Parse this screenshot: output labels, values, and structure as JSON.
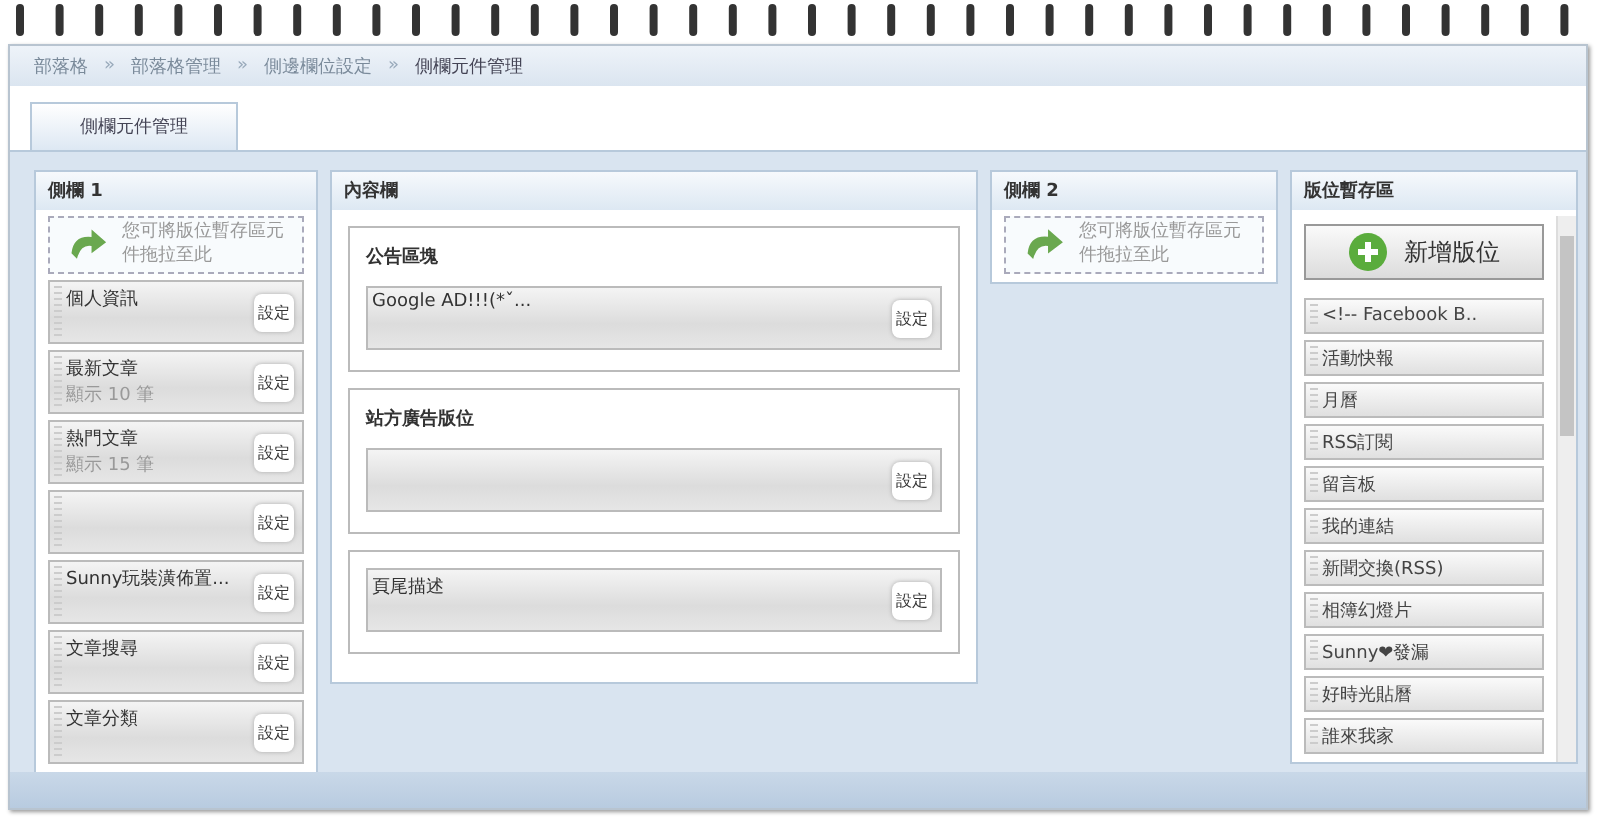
{
  "breadcrumb": {
    "items": [
      "部落格",
      "部落格管理",
      "側邊欄位設定",
      "側欄元件管理"
    ],
    "separator": "»"
  },
  "tabs": [
    {
      "label": "側欄元件管理",
      "selected": true
    }
  ],
  "sidebar_1": {
    "title": "側欄 1",
    "drop_hint": "您可將版位暫存區元件拖拉至此",
    "widgets": [
      {
        "title": "個人資訊",
        "button": "設定"
      },
      {
        "title": "最新文章",
        "subtitle": "顯示 10 筆",
        "button": "設定"
      },
      {
        "title": "熱門文章",
        "subtitle": "顯示 15 筆",
        "button": "設定"
      },
      {
        "button": "設定"
      },
      {
        "title": "Sunny玩裝潢佈置...",
        "button": "設定"
      },
      {
        "title": "文章搜尋",
        "button": "設定"
      },
      {
        "title": "文章分類",
        "button": "設定"
      }
    ]
  },
  "content": {
    "title": "內容欄",
    "blocks": [
      {
        "title": "公告區塊",
        "widgets": [
          {
            "title": "Google AD!!!(*ˇ...",
            "button": "設定"
          }
        ]
      },
      {
        "title": "站方廣告版位",
        "widgets": [
          {
            "button": "設定"
          }
        ]
      },
      {
        "widgets": [
          {
            "title": "頁尾描述",
            "button": "設定"
          }
        ]
      }
    ]
  },
  "sidebar_2": {
    "title": "側欄 2",
    "drop_hint": "您可將版位暫存區元件拖拉至此"
  },
  "storage": {
    "title": "版位暫存區",
    "add_button": "新增版位",
    "items": [
      "<!-- Facebook B..",
      "活動快報",
      "月曆",
      "RSS訂閱",
      "留言板",
      "我的連結",
      "新聞交換(RSS)",
      "相簿幻燈片",
      "Sunny❤發漏",
      "好時光貼曆",
      "誰來我家"
    ]
  }
}
